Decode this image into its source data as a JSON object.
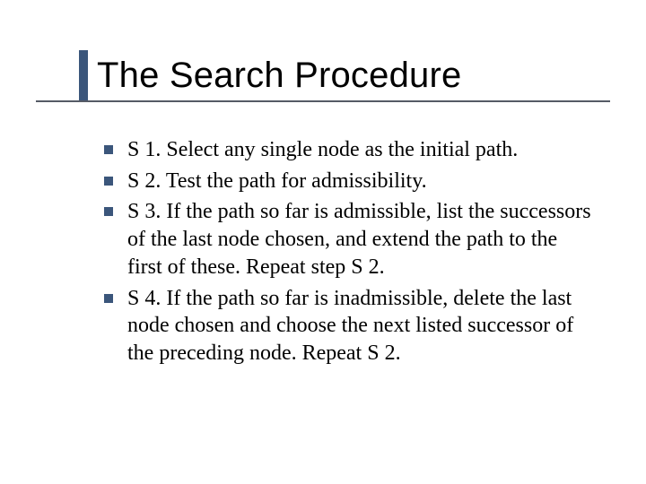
{
  "title": "The Search Procedure",
  "bullets": [
    "S 1. Select any single node as the initial path.",
    "S 2. Test the path for admissibility.",
    "S 3. If the path so far is admissible, list the successors of the last node chosen, and extend the path to the first of these. Repeat step S 2.",
    "S 4. If the path so far is inadmissible, delete the last node chosen and choose the next listed successor of the preceding node. Repeat S 2."
  ]
}
